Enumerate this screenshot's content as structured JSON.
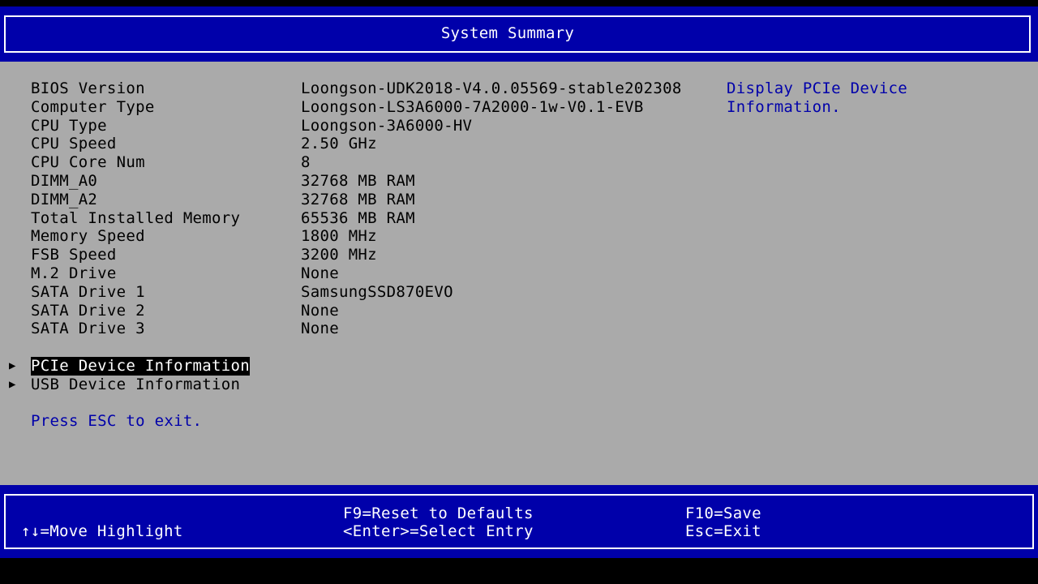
{
  "title": "System Summary",
  "system_info": [
    {
      "label": "BIOS Version",
      "value": "Loongson-UDK2018-V4.0.05569-stable202308"
    },
    {
      "label": "Computer Type",
      "value": "Loongson-LS3A6000-7A2000-1w-V0.1-EVB"
    },
    {
      "label": "CPU Type",
      "value": "Loongson-3A6000-HV"
    },
    {
      "label": "CPU Speed",
      "value": "2.50 GHz"
    },
    {
      "label": "CPU Core Num",
      "value": "8"
    },
    {
      "label": "DIMM_A0",
      "value": "32768 MB RAM"
    },
    {
      "label": "DIMM_A2",
      "value": "32768 MB RAM"
    },
    {
      "label": "Total Installed Memory",
      "value": "65536 MB RAM"
    },
    {
      "label": "Memory Speed",
      "value": "1800 MHz"
    },
    {
      "label": "FSB Speed",
      "value": "3200 MHz"
    },
    {
      "label": "M.2 Drive",
      "value": "None"
    },
    {
      "label": "SATA Drive 1",
      "value": "SamsungSSD870EVO"
    },
    {
      "label": "SATA Drive 2",
      "value": "None"
    },
    {
      "label": "SATA Drive 3",
      "value": "None"
    }
  ],
  "menu_items": [
    {
      "label": "PCIe Device Information",
      "selected": true
    },
    {
      "label": "USB Device Information",
      "selected": false
    }
  ],
  "help_text": [
    "Display PCIe Device",
    "Information."
  ],
  "esc_hint": "Press ESC to exit.",
  "footer": {
    "move_highlight": "↑↓=Move Highlight",
    "reset_defaults": "F9=Reset to Defaults",
    "select_entry": "<Enter>=Select Entry",
    "save": "F10=Save",
    "exit": "Esc=Exit"
  },
  "arrow_icon": "▶",
  "colors": {
    "header_bg": "#0000aa",
    "main_bg": "#aaaaaa",
    "help_text": "#0000aa",
    "selected_bg": "#000000",
    "selected_fg": "#ffffff"
  }
}
